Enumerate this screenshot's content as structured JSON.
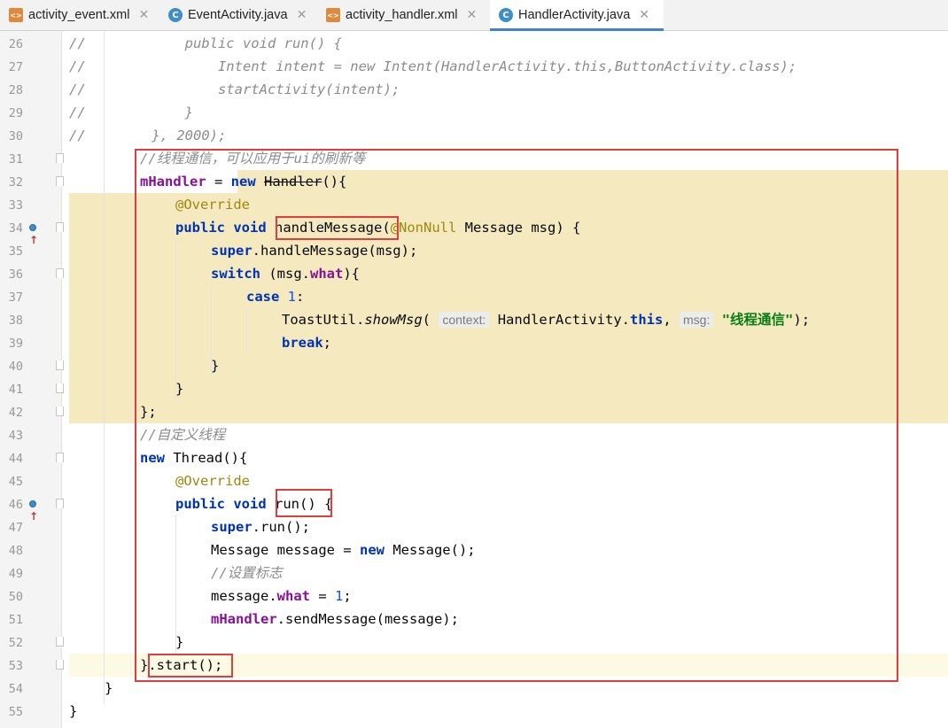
{
  "tabs": [
    {
      "label": "activity_event.xml",
      "type": "xml",
      "icon": "xml-file-icon",
      "active": false
    },
    {
      "label": "EventActivity.java",
      "type": "java",
      "icon": "java-class-icon",
      "active": false
    },
    {
      "label": "activity_handler.xml",
      "type": "xml",
      "icon": "xml-file-icon",
      "active": false
    },
    {
      "label": "HandlerActivity.java",
      "type": "java",
      "icon": "java-class-icon",
      "active": true
    }
  ],
  "close_glyph": "✕",
  "hints": {
    "context": "context:",
    "msg": "msg:"
  },
  "strings": {
    "toast": "\"线程通信\""
  },
  "lines": [
    {
      "n": "26"
    },
    {
      "n": "27"
    },
    {
      "n": "28"
    },
    {
      "n": "29"
    },
    {
      "n": "30"
    },
    {
      "n": "31"
    },
    {
      "n": "32"
    },
    {
      "n": "33"
    },
    {
      "n": "34"
    },
    {
      "n": "35"
    },
    {
      "n": "36"
    },
    {
      "n": "37"
    },
    {
      "n": "38"
    },
    {
      "n": "39"
    },
    {
      "n": "40"
    },
    {
      "n": "41"
    },
    {
      "n": "42"
    },
    {
      "n": "43"
    },
    {
      "n": "44"
    },
    {
      "n": "45"
    },
    {
      "n": "46"
    },
    {
      "n": "47"
    },
    {
      "n": "48"
    },
    {
      "n": "49"
    },
    {
      "n": "50"
    },
    {
      "n": "51"
    },
    {
      "n": "52"
    },
    {
      "n": "53"
    },
    {
      "n": "54"
    },
    {
      "n": "55"
    }
  ],
  "code": {
    "l26": [
      "//",
      "            public void run() {"
    ],
    "l27": [
      "//",
      "                Intent intent = new Intent(HandlerActivity.this,ButtonActivity.class);"
    ],
    "l28": [
      "//",
      "                startActivity(intent);"
    ],
    "l29": [
      "//",
      "            }"
    ],
    "l30": [
      "//",
      "        }, 2000);"
    ],
    "l31": "//线程通信，可以应用于ui的刷新等",
    "l32": [
      "mHandler",
      " = ",
      "new",
      " ",
      "Handler",
      "(){"
    ],
    "l33": "@Override",
    "l34": [
      "public",
      " ",
      "void",
      " ",
      "handleMessage",
      "(",
      "@NonNull",
      " Message msg) {"
    ],
    "l35": [
      "super",
      ".handleMessage(msg);"
    ],
    "l36": [
      "switch",
      " (msg.",
      "what",
      "){"
    ],
    "l37": [
      "case",
      " ",
      "1",
      ":"
    ],
    "l38": [
      "ToastUtil.",
      "showMsg",
      "( ",
      "HandlerActivity.",
      "this",
      ", ",
      ");"
    ],
    "l39": [
      "break",
      ";"
    ],
    "l40": "}",
    "l41": "}",
    "l42": "};",
    "l43": "//自定义线程",
    "l44": [
      "new",
      " Thread(){"
    ],
    "l45": "@Override",
    "l46": [
      "public",
      " ",
      "void",
      " ",
      "run()",
      " {"
    ],
    "l47": [
      "super",
      ".run();"
    ],
    "l48": [
      "Message message = ",
      "new",
      " Message();"
    ],
    "l49": "//设置标志",
    "l50": [
      "message.",
      "what",
      " = ",
      "1",
      ";"
    ],
    "l51": [
      "mHandler",
      ".sendMessage(message);"
    ],
    "l52": "}",
    "l53": [
      "}",
      ".start();"
    ],
    "l54": "}",
    "l55": "}"
  },
  "colors": {
    "highlight_box": "#e23c3c",
    "tab_accent": "#4083c9",
    "block_highlight": "#f5eabf"
  }
}
